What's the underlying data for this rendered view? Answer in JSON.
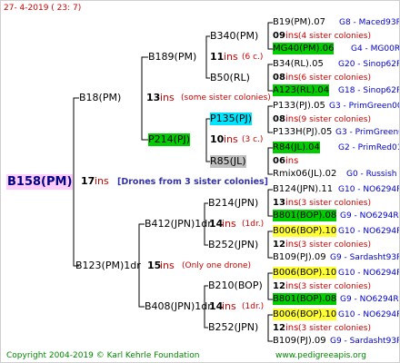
{
  "header": {
    "date": "27-  4-2019 (  23:  7)"
  },
  "footer": {
    "copyright": "Copyright 2004-2019 © Karl Kehrle Foundation",
    "site": "www.pedigreeapis.org"
  },
  "root": {
    "name": "B158(PM)",
    "count": "17",
    "ins": "ins",
    "note": "[Drones from 3 sister colonies]"
  },
  "gen1": [
    {
      "name": "B18(PM)",
      "count": "13",
      "ins": "ins",
      "note": "(some sister colonies)"
    },
    {
      "name": "B123(PM)1dr",
      "count": "15",
      "ins": "ins",
      "note": "(Only one drone)"
    }
  ],
  "gen2": [
    {
      "name": "B189(PM)",
      "count": "11",
      "ins": "ins",
      "note": "(6 c.)"
    },
    {
      "name": "P214(PJ)",
      "count": "10",
      "ins": "ins",
      "note": "(3 c.)"
    },
    {
      "name": "B412(JPN)1dr",
      "count": "14",
      "ins": "ins",
      "note": "(1dr.)"
    },
    {
      "name": "B408(JPN)1dr",
      "count": "14",
      "ins": "ins",
      "note": "(1dr.)"
    }
  ],
  "gen3": [
    {
      "name": "B340(PM)"
    },
    {
      "name": "B50(RL)"
    },
    {
      "name": "P135(PJ)"
    },
    {
      "name": "R85(JL)"
    },
    {
      "name": "B214(JPN)"
    },
    {
      "name": "B252(JPN)"
    },
    {
      "name": "B210(BOP)"
    },
    {
      "name": "B252(JPN)"
    }
  ],
  "gen4": [
    {
      "top": "B19(PM).07",
      "topcode": "G8 - Maced93R",
      "count": "09",
      "ins": "ins",
      "note": "(4 sister colonies)",
      "bottom": "MG40(PM).06",
      "bottomcode": "G4 - MG00R"
    },
    {
      "top": "B34(RL).05",
      "topcode": "G20 - Sinop62R",
      "count": "08",
      "ins": "ins",
      "note": "(6 sister colonies)",
      "bottom": "A123(RL).04",
      "bottomcode": "G18 - Sinop62R"
    },
    {
      "top": "P133(PJ).05",
      "topcode": "G3 - PrimGreen00",
      "count": "08",
      "ins": "ins",
      "note": "(9 sister colonies)",
      "bottom": "P133H(PJ).05",
      "bottomcode": "G3 - PrimGreen00"
    },
    {
      "top": "R84(JL).04",
      "topcode": "G2 - PrimRed01",
      "count": "06",
      "ins": "ins",
      "note": "",
      "bottom": "Rmix06(JL).02",
      "bottomcode": "G0 - Russish"
    },
    {
      "top": "B124(JPN).11",
      "topcode": "G10 - NO6294R",
      "count": "13",
      "ins": "ins",
      "note": "(3 sister colonies)",
      "bottom": "B801(BOP).08",
      "bottomcode": "G9 - NO6294R"
    },
    {
      "top": "B006(BOP).10",
      "topcode": "G10 - NO6294R",
      "count": "12",
      "ins": "ins",
      "note": "(3 sister colonies)",
      "bottom": "B109(PJ).09",
      "bottomcode": "G9 - Sardasht93R"
    },
    {
      "top": "B006(BOP).10",
      "topcode": "G10 - NO6294R",
      "count": "12",
      "ins": "ins",
      "note": "(3 sister colonies)",
      "bottom": "B801(BOP).08",
      "bottomcode": "G9 - NO6294R"
    },
    {
      "top": "B006(BOP).10",
      "topcode": "G10 - NO6294R",
      "count": "12",
      "ins": "ins",
      "note": "(3 sister colonies)",
      "bottom": "B109(PJ).09",
      "bottomcode": "G9 - Sardasht93R"
    }
  ],
  "colors": {
    "line": "#000000",
    "ins": "#cc0000",
    "code": "#0000cc",
    "green": "#00cc00",
    "cyan": "#00e5ff",
    "yellow": "#ffff33",
    "gray": "#c0c0c0",
    "root_bg": "#ffccff"
  }
}
